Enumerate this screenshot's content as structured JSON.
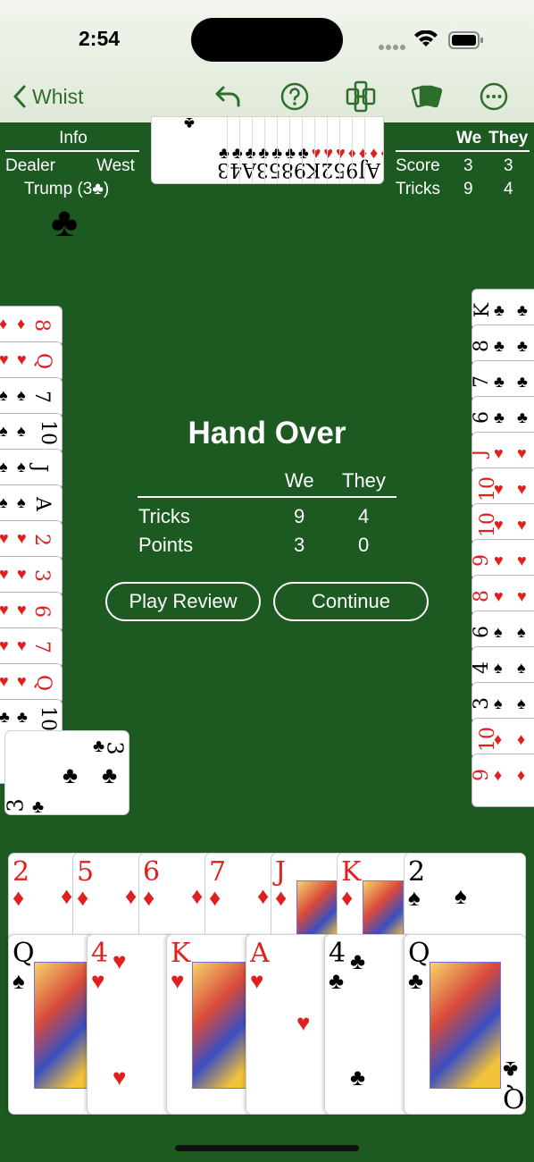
{
  "status": {
    "time": "2:54"
  },
  "nav": {
    "back_label": "Whist"
  },
  "info": {
    "title": "Info",
    "dealer_label": "Dealer",
    "dealer_value": "West",
    "trump_label": "Trump (3♣)",
    "trump_suit": "♣"
  },
  "score_panel": {
    "col_we": "We",
    "col_they": "They",
    "rows": [
      {
        "label": "Score",
        "we": "3",
        "they": "3"
      },
      {
        "label": "Tricks",
        "we": "9",
        "they": "4"
      }
    ]
  },
  "north_hand": {
    "ranks": "AJ952K9853A43"
  },
  "hand_over": {
    "title": "Hand Over",
    "col_we": "We",
    "col_they": "They",
    "rows": [
      {
        "label": "Tricks",
        "we": "9",
        "they": "4"
      },
      {
        "label": "Points",
        "we": "3",
        "they": "0"
      }
    ],
    "play_review_label": "Play Review",
    "continue_label": "Continue"
  },
  "west_hand": [
    "8",
    "Q",
    "7",
    "10",
    "J",
    "A",
    "2",
    "3",
    "6",
    "7",
    "Q",
    "10"
  ],
  "east_hand": [
    "K",
    "8",
    "7",
    "6",
    "J",
    "10",
    "10",
    "9",
    "8",
    "6",
    "4",
    "3",
    "10",
    "9"
  ],
  "west_played": {
    "rank": "3",
    "suit": "♣"
  },
  "south_hand": {
    "back_row": [
      {
        "rank": "2",
        "suit": "♦"
      },
      {
        "rank": "5",
        "suit": "♦"
      },
      {
        "rank": "6",
        "suit": "♦"
      },
      {
        "rank": "7",
        "suit": "♦"
      },
      {
        "rank": "J",
        "suit": "♦"
      },
      {
        "rank": "K",
        "suit": "♦"
      },
      {
        "rank": "2",
        "suit": "♠"
      }
    ],
    "front_row": [
      {
        "rank": "Q",
        "suit": "♠"
      },
      {
        "rank": "4",
        "suit": "♥"
      },
      {
        "rank": "K",
        "suit": "♥"
      },
      {
        "rank": "A",
        "suit": "♥"
      },
      {
        "rank": "4",
        "suit": "♣"
      },
      {
        "rank": "Q",
        "suit": "♣"
      }
    ]
  },
  "colors": {
    "felt": "#1c5a22",
    "accent": "#2e6e2c",
    "red_suit": "#e0201f"
  }
}
